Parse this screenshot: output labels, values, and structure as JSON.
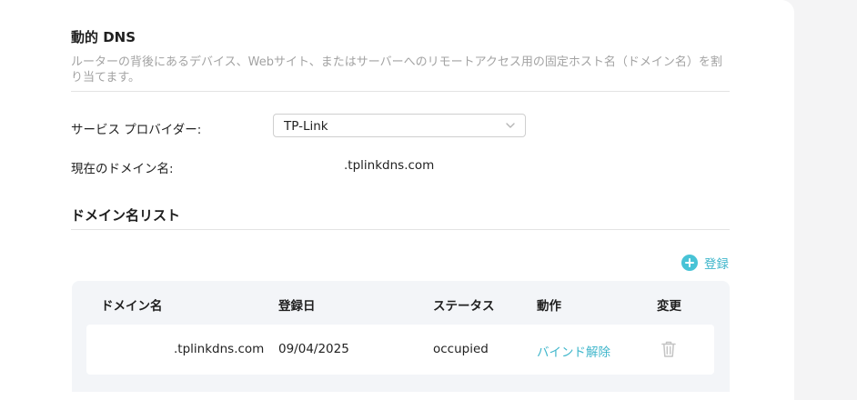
{
  "section": {
    "title": "動的 DNS",
    "description": "ルーターの背後にあるデバイス、Webサイト、またはサーバーへのリモートアクセス用の固定ホスト名（ドメイン名）を割り当てます。"
  },
  "form": {
    "provider_label": "サービス プロバイダー:",
    "provider_value": "TP-Link",
    "current_domain_label": "現在のドメイン名:",
    "current_domain_value": ".tplinkdns.com"
  },
  "domain_list": {
    "title": "ドメイン名リスト",
    "add_label": "登録",
    "columns": [
      "ドメイン名",
      "登録日",
      "ステータス",
      "動作",
      "変更"
    ],
    "rows": [
      {
        "domain": ".tplinkdns.com",
        "date": "09/04/2025",
        "status": "occupied",
        "action": "バインド解除",
        "modify_icon": "trash-icon"
      }
    ]
  },
  "colors": {
    "accent": "#48c3d6",
    "link": "#3fb6cb",
    "muted_text": "#a3a3a3",
    "table_bg": "#f3f5f8",
    "icon_gray": "#c4c4c4"
  }
}
